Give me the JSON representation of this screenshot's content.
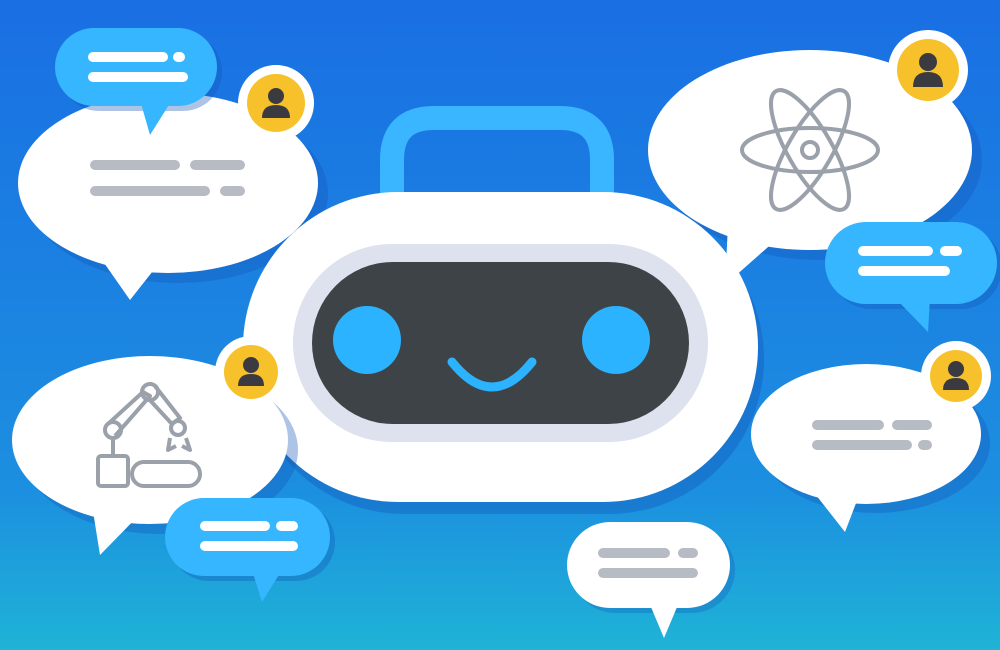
{
  "colors": {
    "background_top": "#1a6fe3",
    "background_bottom": "#1fb3d6",
    "bubble_white": "#ffffff",
    "bubble_blue": "#35b6ff",
    "text_line_gray": "#b7bcc4",
    "text_line_white": "#ffffff",
    "avatar_badge": "#f6c12a",
    "avatar_figure": "#3a3a40",
    "robot_body": "#ffffff",
    "robot_visor_rim": "#dde2ee",
    "robot_face": "#3e4347",
    "robot_eyes_mouth": "#2cb3ff",
    "robot_handle": "#3ab5ff",
    "icon_stroke": "#9aa1aa",
    "shadow": "#1457b8"
  },
  "robot": {
    "expression": "smile",
    "icons": [
      "handle-icon",
      "eye-icon",
      "smile-icon"
    ]
  },
  "bubbles": [
    {
      "id": "bubble-blue-top-left",
      "style": "blue",
      "content": "text-lines"
    },
    {
      "id": "bubble-white-top-left",
      "style": "white",
      "content": "text-lines",
      "avatar": "user-avatar-icon"
    },
    {
      "id": "bubble-white-top-right",
      "style": "white",
      "content": "atom-icon",
      "avatar": "user-avatar-icon"
    },
    {
      "id": "bubble-blue-right",
      "style": "blue",
      "content": "text-lines"
    },
    {
      "id": "bubble-white-bottom-left",
      "style": "white",
      "content": "robotic-arm-icon",
      "avatar": "user-avatar-icon"
    },
    {
      "id": "bubble-blue-bottom-left",
      "style": "blue",
      "content": "text-lines"
    },
    {
      "id": "bubble-white-bottom-right",
      "style": "white",
      "content": "text-lines",
      "avatar": "user-avatar-icon"
    },
    {
      "id": "bubble-white-bottom-center",
      "style": "white",
      "content": "text-lines"
    }
  ]
}
